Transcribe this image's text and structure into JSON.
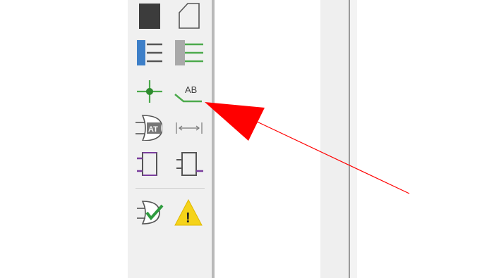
{
  "toolbar": {
    "tools": [
      {
        "name": "filled-rect-tool",
        "icon": "filled-rectangle-icon"
      },
      {
        "name": "sheet-outline-tool",
        "icon": "sheet-outline-icon"
      },
      {
        "name": "bus-entry-blue-tool",
        "icon": "bus-entry-blue-icon"
      },
      {
        "name": "bus-entry-green-tool",
        "icon": "bus-entry-green-icon"
      },
      {
        "name": "junction-tool",
        "icon": "junction-icon"
      },
      {
        "name": "net-label-tool",
        "icon": "net-label-icon",
        "text": "AB"
      },
      {
        "name": "attribute-tool",
        "icon": "attribute-icon",
        "text": "AT"
      },
      {
        "name": "dimension-tool",
        "icon": "dimension-icon"
      },
      {
        "name": "port-left-tool",
        "icon": "port-left-icon"
      },
      {
        "name": "port-right-tool",
        "icon": "port-right-icon"
      },
      {
        "name": "check-gate-tool",
        "icon": "check-gate-icon"
      },
      {
        "name": "warning-tool",
        "icon": "warning-icon",
        "text": "!"
      }
    ]
  },
  "annotation": {
    "icon": "red-arrow-pointer",
    "color": "#ff0000"
  }
}
